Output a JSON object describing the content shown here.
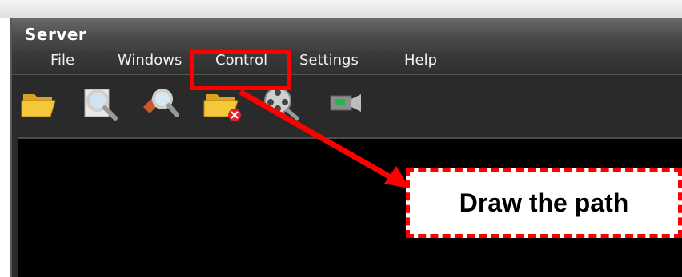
{
  "window": {
    "title": "Server"
  },
  "menu": {
    "items": [
      {
        "label": "File"
      },
      {
        "label": "Windows"
      },
      {
        "label": "Control"
      },
      {
        "label": "Settings"
      },
      {
        "label": "Help"
      }
    ]
  },
  "toolbar": {
    "tools": [
      {
        "icon": "open-folder-icon"
      },
      {
        "icon": "search-icon"
      },
      {
        "icon": "search-edit-icon"
      },
      {
        "icon": "folder-delete-icon"
      },
      {
        "icon": "film-reel-search-icon"
      },
      {
        "icon": "video-camera-icon"
      }
    ]
  },
  "annotation": {
    "callout_text": "Draw the path",
    "color": "#ff0000"
  }
}
